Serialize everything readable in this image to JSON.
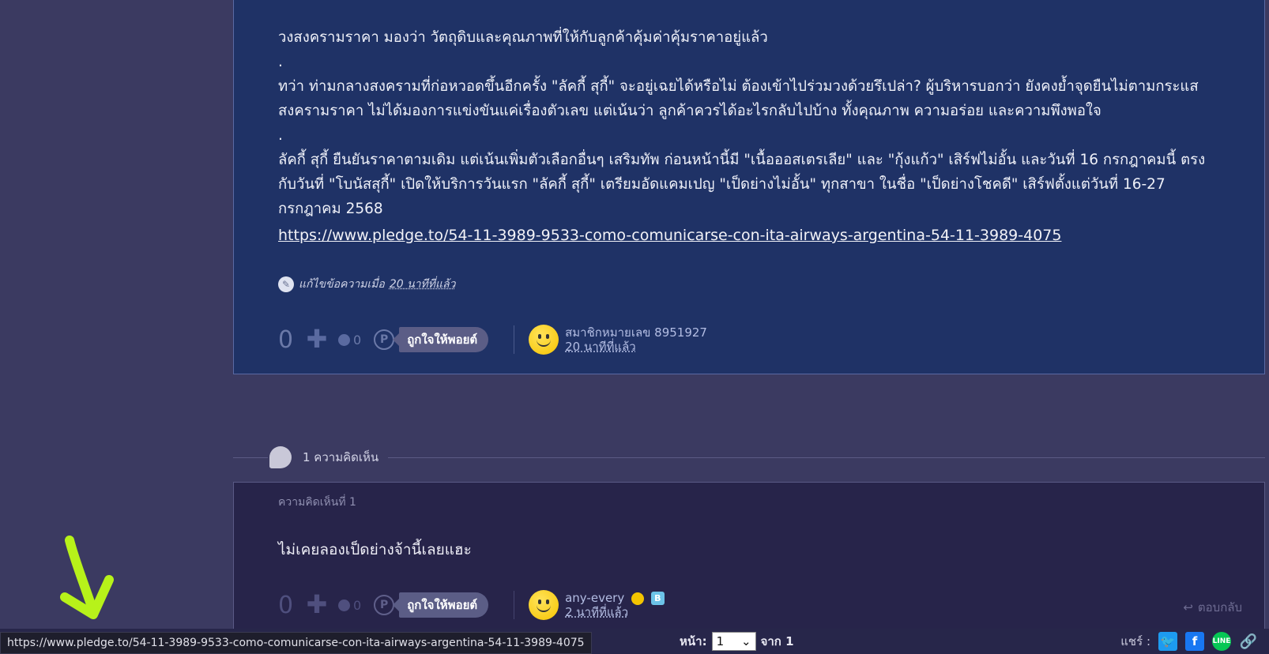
{
  "topic": {
    "lines": [
      "วงสงครามราคา มองว่า วัตถุดิบและคุณภาพที่ให้กับลูกค้าคุ้มค่าคุ้มราคาอยู่แล้ว",
      ".",
      "ทว่า ท่ามกลางสงครามที่ก่อหวอดขึ้นอีกครั้ง \"ลัคกี้ สุกี้\" จะอยู่เฉยได้หรือไม่ ต้องเข้าไปร่วมวงด้วยรึเปล่า? ผู้บริหารบอกว่า ยังคงย้ำจุดยืนไม่ตามกระแส",
      "สงครามราคา ไม่ได้มองการแข่งขันแค่เรื่องตัวเลข แต่เน้นว่า ลูกค้าควรได้อะไรกลับไปบ้าง ทั้งคุณภาพ ความอร่อย และความพึงพอใจ",
      ".",
      "ลัคกี้ สุกี้ ยืนยันราคาตามเดิม แต่เน้นเพิ่มตัวเลือกอื่นๆ เสริมทัพ ก่อนหน้านี้มี \"เนื้อออสเตรเลีย\" และ \"กุ้งแก้ว\" เสิร์ฟไม่อั้น และวันที่ 16 กรกฎาคมนี้ ตรง",
      "กับวันที่ \"โบนัสสุกี้\" เปิดให้บริการวันแรก \"ลัคกี้ สุกี้\" เตรียมอัดแคมเปญ \"เป็ดย่างไม่อั้น\" ทุกสาขา ในชื่อ \"เป็ดย่างโชคดี\" เสิร์ฟตั้งแต่วันที่ 16-27",
      "กรกฎาคม 2568"
    ],
    "link": "https://www.pledge.to/54-11-3989-9533-como-comunicarse-con-ita-airways-argentina-54-11-3989-4075",
    "edit_label": "แก้ไขข้อความเมื่อ",
    "edit_time": "20 นาทีที่แล้ว",
    "vote_count": "0",
    "emo_count": "0",
    "point_label": "ถูกใจให้พอยต์",
    "author": "สมาชิกหมายเลข 8951927",
    "author_time": "20 นาทีที่แล้ว"
  },
  "comments_header": {
    "count_label": "1 ความคิดเห็น"
  },
  "comment": {
    "number_label": "ความคิดเห็นที่ 1",
    "text": "ไม่เคยลองเป็ดย่างจ้านี้เลยแฮะ",
    "vote_count": "0",
    "emo_count": "0",
    "point_label": "ถูกใจให้พอยต์",
    "author": "any-every",
    "badge": "B",
    "author_time": "2 นาทีที่แล้ว",
    "reply_label": "ตอบกลับ"
  },
  "pager": {
    "label": "หน้า:",
    "current": "1",
    "of_label": "จาก 1"
  },
  "share": {
    "label": "แชร์ :",
    "line_label": "LINE"
  },
  "status_url": "https://www.pledge.to/54-11-3989-9533-como-comunicarse-con-ita-airways-argentina-54-11-3989-4075",
  "colors": {
    "annotation_arrow": "#b7f21a",
    "topic_bg": "#1f3266",
    "page_bg": "#3b3a61"
  }
}
